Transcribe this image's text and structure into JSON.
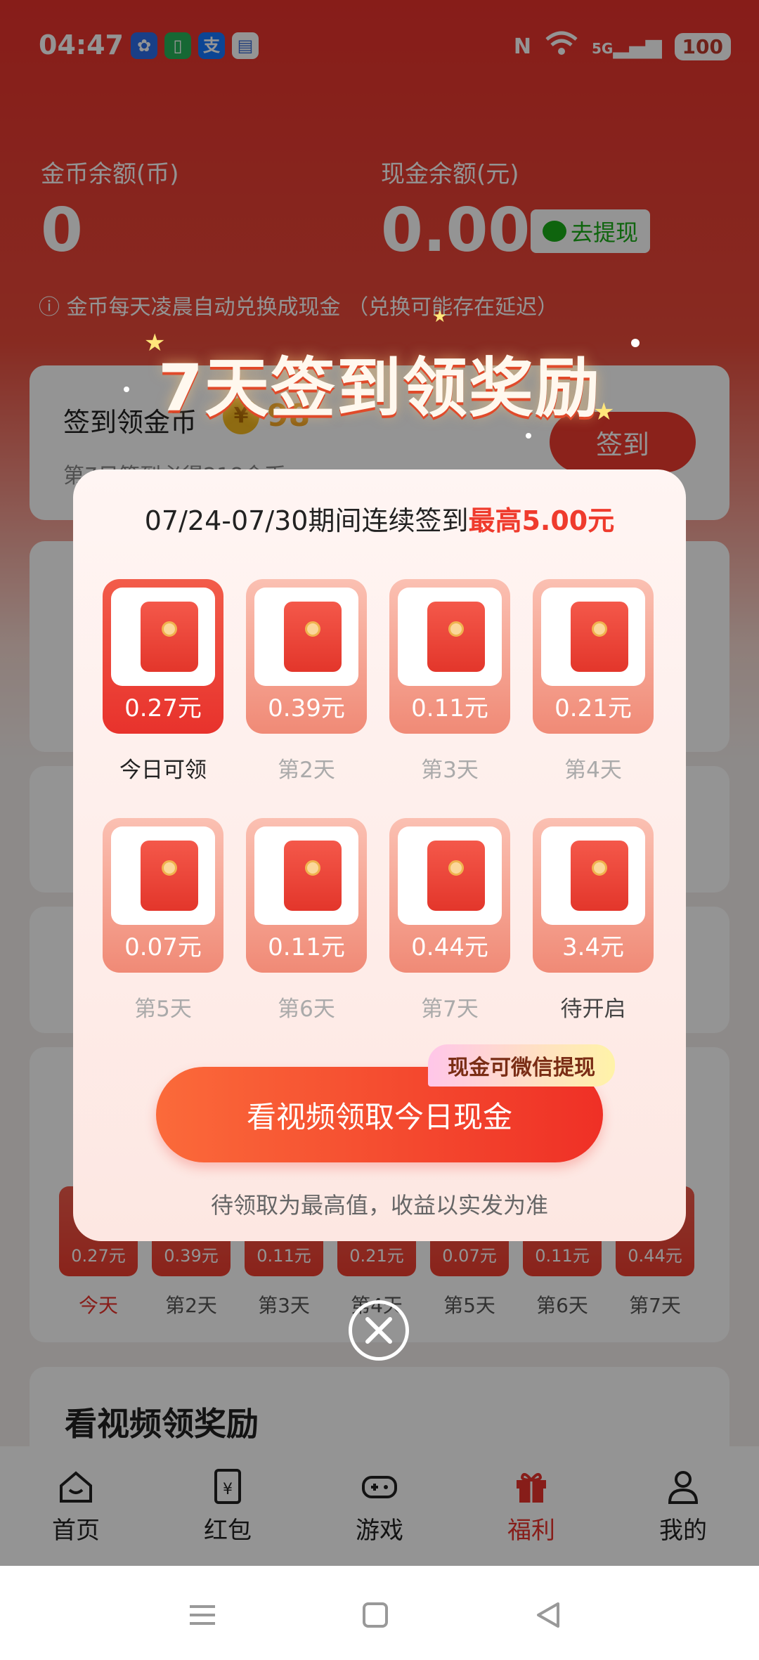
{
  "status_bar": {
    "time": "04:47",
    "network": "5G",
    "battery": "100"
  },
  "balances": {
    "coin_label": "金币余额(币)",
    "coin_value": "0",
    "cash_label": "现金余额(元)",
    "cash_value": "0.00",
    "withdraw_label": "去提现",
    "note": "ⓘ 金币每天凌晨自动兑换成现金 （兑换可能存在延迟）"
  },
  "checkin_card": {
    "title": "签到领金币",
    "coin_symbol": "¥",
    "coins": "98",
    "subtitle": "第7日签到必得218金币",
    "button": "签到"
  },
  "background_strip": {
    "amounts": [
      "0.27元",
      "0.39元",
      "0.11元",
      "0.21元",
      "0.07元",
      "0.11元",
      "0.44元"
    ],
    "labels": [
      "今天",
      "第2天",
      "第3天",
      "第4天",
      "第5天",
      "第6天",
      "第7天"
    ]
  },
  "video_section_title": "看视频领奖励",
  "tabbar": {
    "items": [
      "首页",
      "红包",
      "游戏",
      "福利",
      "我的"
    ]
  },
  "modal": {
    "headline": "7天签到领奖励",
    "period_text": "07/24-07/30期间连续签到",
    "max_text": "最高5.00元",
    "rewards": [
      {
        "amount": "0.27元",
        "label": "今日可领"
      },
      {
        "amount": "0.39元",
        "label": "第2天"
      },
      {
        "amount": "0.11元",
        "label": "第3天"
      },
      {
        "amount": "0.21元",
        "label": "第4天"
      },
      {
        "amount": "0.07元",
        "label": "第5天"
      },
      {
        "amount": "0.11元",
        "label": "第6天"
      },
      {
        "amount": "0.44元",
        "label": "第7天"
      },
      {
        "amount": "3.4元",
        "label": "待开启"
      }
    ],
    "tag": "现金可微信提现",
    "cta": "看视频领取今日现金",
    "note": "待领取为最高值，收益以实发为准"
  },
  "colors": {
    "accent": "#ef3b2d",
    "wechat_green": "#1aad19"
  }
}
